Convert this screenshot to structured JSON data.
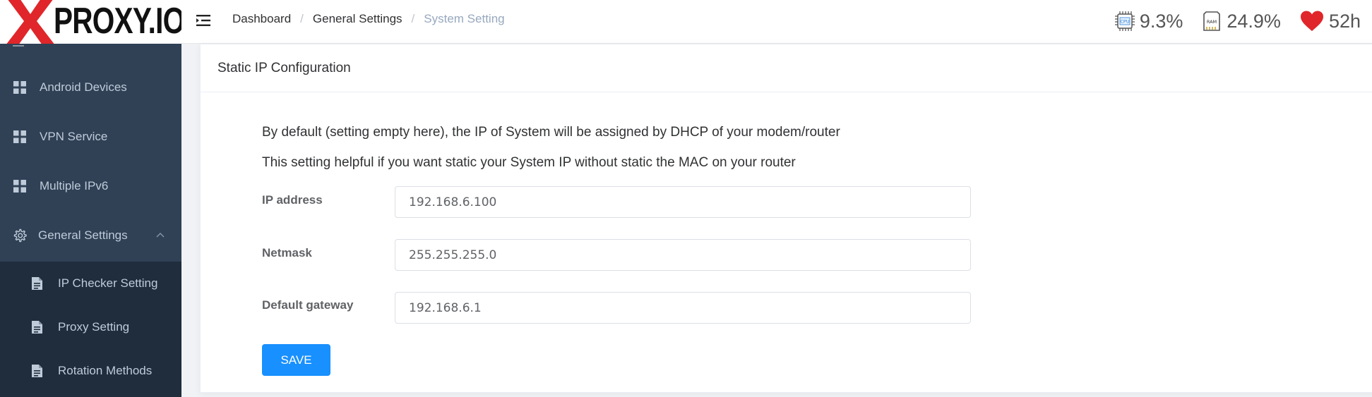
{
  "logo": {
    "brand_text": "PROXY.IO",
    "x_letter": "X"
  },
  "breadcrumb": {
    "items": [
      "Dashboard",
      "General Settings",
      "System Setting"
    ],
    "separator": "/"
  },
  "stats": {
    "cpu": {
      "icon": "cpu-chip-icon",
      "chip_text": "CPU",
      "value": "9.3%"
    },
    "ram": {
      "icon": "ram-chip-icon",
      "chip_text": "RAM",
      "value": "24.9%"
    },
    "uptime": {
      "icon": "heart-icon",
      "value": "52h"
    }
  },
  "sidebar": {
    "items": [
      {
        "label": "Android Devices",
        "icon": "grid-icon"
      },
      {
        "label": "VPN Service",
        "icon": "grid-icon"
      },
      {
        "label": "Multiple IPv6",
        "icon": "grid-icon"
      },
      {
        "label": "General Settings",
        "icon": "gear-icon",
        "expanded": true
      }
    ],
    "submenu": [
      {
        "label": "IP Checker Setting",
        "icon": "document-icon"
      },
      {
        "label": "Proxy Setting",
        "icon": "document-icon"
      },
      {
        "label": "Rotation Methods",
        "icon": "document-icon"
      }
    ]
  },
  "card": {
    "title": "Static IP Configuration",
    "desc1": "By default (setting empty here), the IP of System will be assigned by DHCP of your modem/router",
    "desc2": "This setting helpful if you want static your System IP without static the MAC on your router",
    "fields": {
      "ip": {
        "label": "IP address",
        "value": "192.168.6.100"
      },
      "netmask": {
        "label": "Netmask",
        "value": "255.255.255.0"
      },
      "gateway": {
        "label": "Default gateway",
        "value": "192.168.6.1"
      }
    },
    "save_label": "SAVE"
  },
  "colors": {
    "sidebar_bg": "#304156",
    "submenu_bg": "#1f2d3d",
    "accent": "#1890ff",
    "logo_x": "#e0262a",
    "heart": "#e0262a"
  }
}
